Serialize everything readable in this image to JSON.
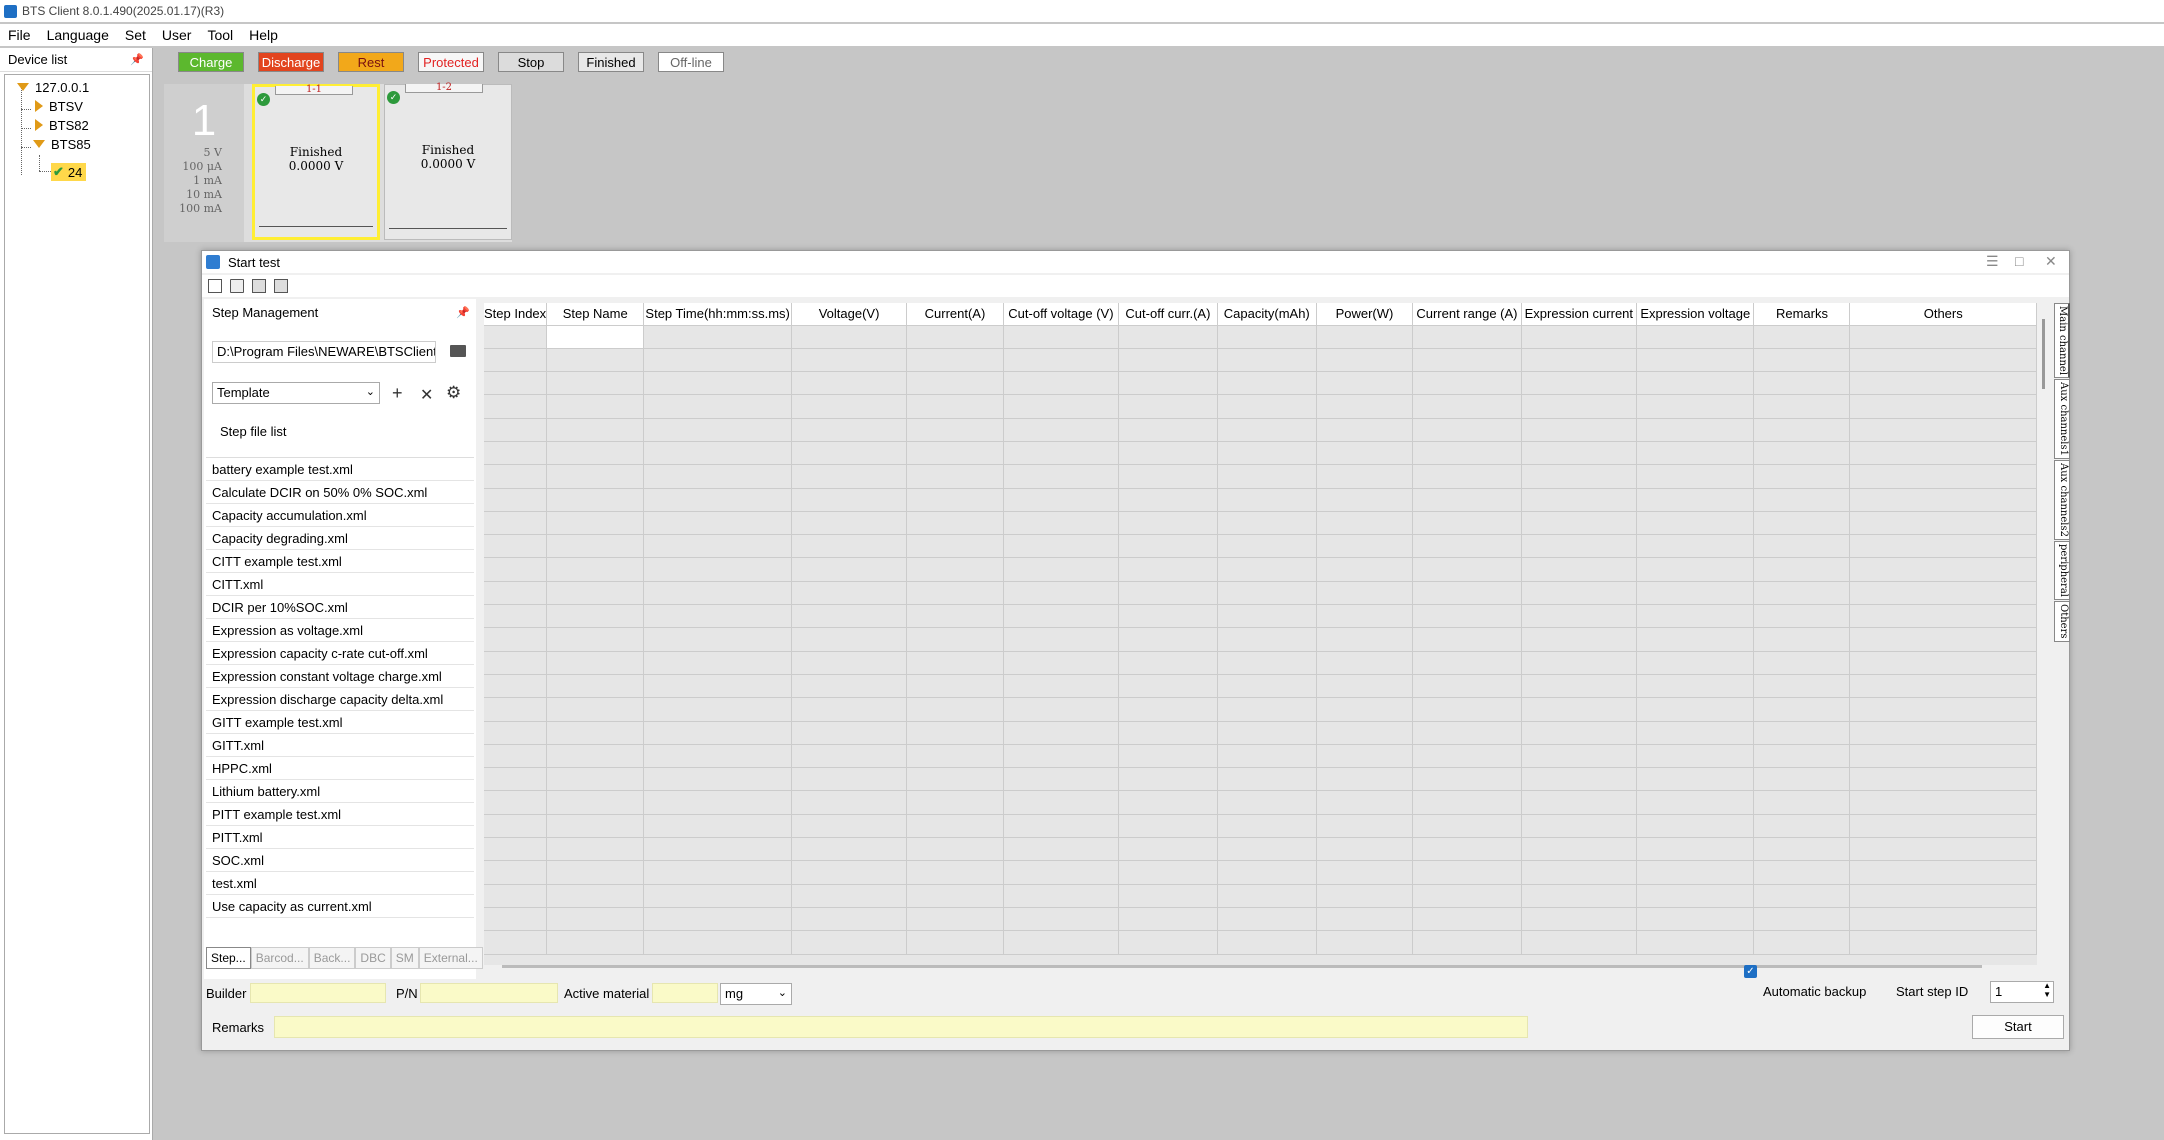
{
  "window": {
    "title": "BTS Client 8.0.1.490(2025.01.17)(R3)"
  },
  "menu": [
    "File",
    "Language",
    "Set",
    "User",
    "Tool",
    "Help"
  ],
  "device_list": {
    "header": "Device list",
    "nodes": [
      "127.0.0.1",
      "BTSV",
      "BTS82",
      "BTS85",
      "24"
    ]
  },
  "legend": [
    {
      "label": "Charge",
      "bg": "#5cb82e",
      "fg": "#ffffff"
    },
    {
      "label": "Discharge",
      "bg": "#e2441e",
      "fg": "#ffffff"
    },
    {
      "label": "Rest",
      "bg": "#f2a81a",
      "fg": "#7a1010"
    },
    {
      "label": "Protected",
      "bg": "#f7f7f7",
      "fg": "#e22222"
    },
    {
      "label": "Stop",
      "bg": "#dcdcdc",
      "fg": "#000000"
    },
    {
      "label": "Finished",
      "bg": "#e8e8e8",
      "fg": "#000000"
    },
    {
      "label": "Off-line",
      "bg": "#ffffff",
      "fg": "#666666"
    }
  ],
  "unit": {
    "number": "1",
    "ranges": [
      "5 V",
      "100 μA",
      "1 mA",
      "10 mA",
      "100 mA"
    ]
  },
  "channels": [
    {
      "id": "1-1",
      "status": "Finished",
      "voltage": "0.0000 V"
    },
    {
      "id": "1-2",
      "status": "Finished",
      "voltage": "0.0000 V"
    }
  ],
  "dialog": {
    "title": "Start test",
    "step_management": {
      "header": "Step Management",
      "path": "D:\\Program Files\\NEWARE\\BTSClient8",
      "template": "Template",
      "step_file_list_label": "Step file list",
      "files": [
        "battery example test.xml",
        "Calculate DCIR on 50% 0% SOC.xml",
        "Capacity accumulation.xml",
        "Capacity degrading.xml",
        "CITT example test.xml",
        "CITT.xml",
        "DCIR per 10%SOC.xml",
        "Expression as voltage.xml",
        "Expression capacity c-rate cut-off.xml",
        "Expression constant voltage charge.xml",
        "Expression discharge capacity delta.xml",
        "GITT example test.xml",
        "GITT.xml",
        "HPPC.xml",
        "Lithium battery.xml",
        "PITT example test.xml",
        "PITT.xml",
        "SOC.xml",
        "test.xml",
        "Use capacity as current.xml"
      ],
      "bottom_tabs": [
        "Step...",
        "Barcod...",
        "Back...",
        "DBC",
        "SM",
        "External..."
      ]
    },
    "grid": {
      "columns": [
        "Step Index",
        "Step Name",
        "Step Time(hh:mm:ss.ms)",
        "Voltage(V)",
        "Current(A)",
        "Cut-off voltage (V)",
        "Cut-off curr.(A)",
        "Capacity(mAh)",
        "Power(W)",
        "Current range (A)",
        "Expression current",
        "Expression voltage",
        "Remarks",
        "Others"
      ]
    },
    "side_tabs": [
      "Main channel",
      "Aux channels1",
      "Aux channels2",
      "peripheral",
      "Others"
    ],
    "form": {
      "builder_label": "Builder",
      "pn_label": "P/N",
      "active_material_label": "Active material",
      "unit_value": "mg",
      "auto_backup_label": "Automatic backup",
      "start_step_id_label": "Start step ID",
      "start_step_id_value": "1",
      "remarks_label": "Remarks",
      "start_button": "Start"
    }
  }
}
